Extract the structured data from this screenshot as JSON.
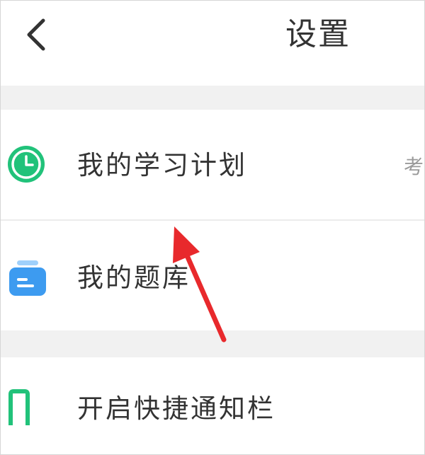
{
  "header": {
    "title": "设置"
  },
  "settings": {
    "items": [
      {
        "label": "我的学习计划",
        "value": "考",
        "icon": "clock-icon",
        "icon_color": "#21c27a"
      },
      {
        "label": "我的题库",
        "icon": "question-bank-icon",
        "icon_color": "#3d9bf0"
      },
      {
        "label": "开启快捷通知栏",
        "icon": "phone-outline-icon",
        "icon_color": "#21c27a"
      }
    ]
  },
  "colors": {
    "section_gap": "#f1f1f1",
    "divider": "#ececec",
    "text": "#333333",
    "annotation_arrow": "#e8292c"
  }
}
